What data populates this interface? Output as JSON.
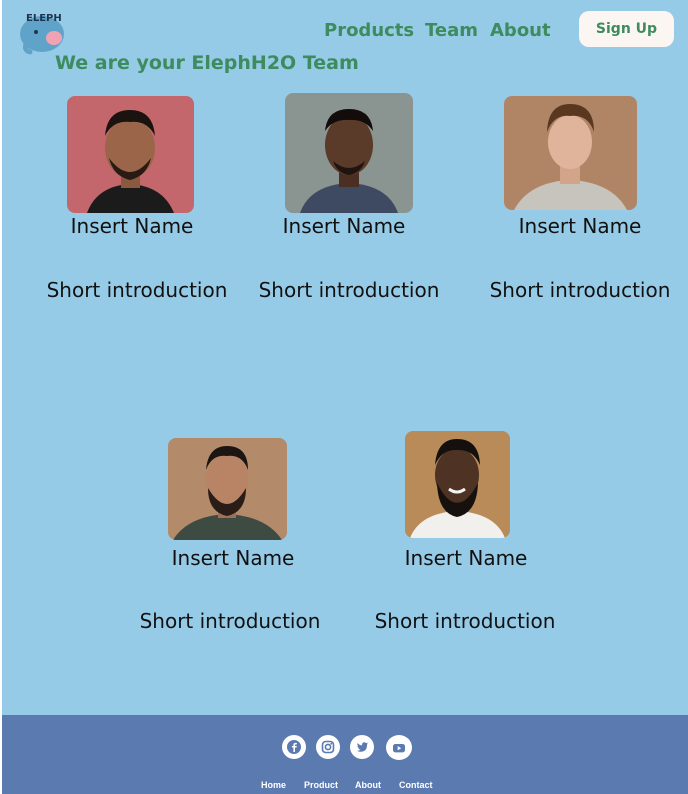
{
  "header": {
    "logo_text": "ELEPH",
    "nav": [
      "Products",
      "Team",
      "About"
    ],
    "signup_label": "Sign Up"
  },
  "page_title": "We are your ElephH2O Team",
  "members": [
    {
      "name": "Insert Name",
      "intro": "Short introduction"
    },
    {
      "name": "Insert Name",
      "intro": "Short introduction"
    },
    {
      "name": "Insert Name",
      "intro": "Short introduction"
    },
    {
      "name": "Insert Name",
      "intro": "Short introduction"
    },
    {
      "name": "Insert Name",
      "intro": "Short introduction"
    }
  ],
  "footer": {
    "social_icons": [
      "facebook-icon",
      "instagram-icon",
      "twitter-icon",
      "youtube-icon"
    ],
    "links": [
      "Home",
      "Product",
      "About",
      "Contact"
    ]
  },
  "colors": {
    "page_bg": "#96cbe7",
    "accent_green": "#3d8b5e",
    "footer_bg": "#5b7ab0",
    "signup_bg": "#fbf6f1"
  }
}
